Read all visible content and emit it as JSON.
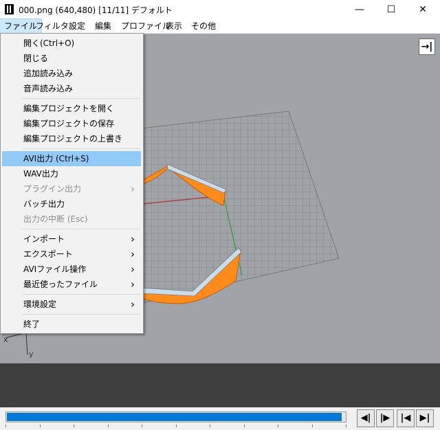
{
  "window": {
    "title": "000.png (640,480)  [11/11]  デフォルト",
    "minimize": "—",
    "maximize": "☐",
    "close": "✕"
  },
  "menubar": [
    "ファイル",
    "フィルタ",
    "設定",
    "編集",
    "プロファイル",
    "表示",
    "その他"
  ],
  "file_menu": [
    {
      "label": "開く(Ctrl+O)"
    },
    {
      "label": "閉じる"
    },
    {
      "label": "追加読み込み"
    },
    {
      "label": "音声読み込み"
    },
    {
      "separator": true
    },
    {
      "label": "編集プロジェクトを開く"
    },
    {
      "label": "編集プロジェクトの保存"
    },
    {
      "label": "編集プロジェクトの上書き"
    },
    {
      "separator": true
    },
    {
      "label": "AVI出力 (Ctrl+S)",
      "highlighted": true
    },
    {
      "label": "WAV出力"
    },
    {
      "label": "プラグイン出力",
      "disabled": true,
      "submenu": true
    },
    {
      "label": "バッチ出力"
    },
    {
      "label": "出力の中断 (Esc)",
      "disabled": true
    },
    {
      "separator": true
    },
    {
      "label": "インポート",
      "submenu": true
    },
    {
      "label": "エクスポート",
      "submenu": true
    },
    {
      "label": "AVIファイル操作",
      "submenu": true
    },
    {
      "label": "最近使ったファイル",
      "submenu": true
    },
    {
      "separator": true
    },
    {
      "label": "環境設定",
      "submenu": true
    },
    {
      "separator": true
    },
    {
      "label": "終了"
    }
  ],
  "viewport": {
    "toggle_icon": "→|",
    "axis_x_label": "x",
    "axis_y_label": "y"
  },
  "seekbar": {
    "progress": 0.99
  },
  "nav_buttons": [
    {
      "name": "prev-frame-button",
      "glyph": "◀|"
    },
    {
      "name": "next-frame-button",
      "glyph": "|▶"
    },
    {
      "name": "first-frame-button",
      "glyph": "|◀"
    },
    {
      "name": "last-frame-button",
      "glyph": "▶|"
    }
  ],
  "colors": {
    "accent": "#0078d7",
    "menu_highlight": "#91c9f7",
    "viewport_bg": "#a0a3a8",
    "shape_orange": "#ff8c1a"
  }
}
